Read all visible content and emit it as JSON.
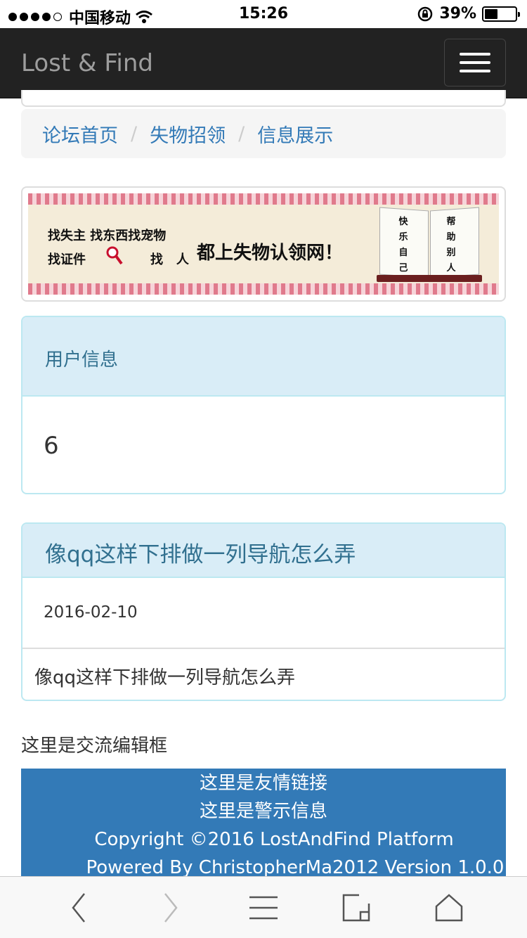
{
  "status_bar": {
    "carrier": "中国移动",
    "time": "15:26",
    "battery_percent": "39%",
    "battery_level": 0.39
  },
  "navbar": {
    "brand": "Lost & Find"
  },
  "breadcrumb": [
    {
      "label": "论坛首页"
    },
    {
      "label": "失物招领"
    },
    {
      "label": "信息展示"
    }
  ],
  "banner": {
    "line1": "找失主 找东西找宠物",
    "line2_a": "找证件",
    "line2_b": "找",
    "line2_c": "人",
    "slogan": "都上失物认领网！",
    "book_left": "快乐自己",
    "book_right": "帮助别人"
  },
  "user_panel": {
    "title": "用户信息",
    "value": "6"
  },
  "post_panel": {
    "title": "像qq这样下排做一列导航怎么弄",
    "date": "2016-02-10",
    "content": "像qq这样下排做一列导航怎么弄"
  },
  "editor": {
    "label": "这里是交流编辑框"
  },
  "footer": {
    "links": "这里是友情链接",
    "warning": "这里是警示信息",
    "copyright": "Copyright ©2016 LostAndFind Platform",
    "powered": "Powered By ChristopherMa2012 Version 1.0.0"
  },
  "icons": {
    "back": "chevron-left-icon",
    "forward": "chevron-right-icon",
    "bookmarks": "menu-icon",
    "share": "share-icon",
    "home": "home-icon"
  }
}
